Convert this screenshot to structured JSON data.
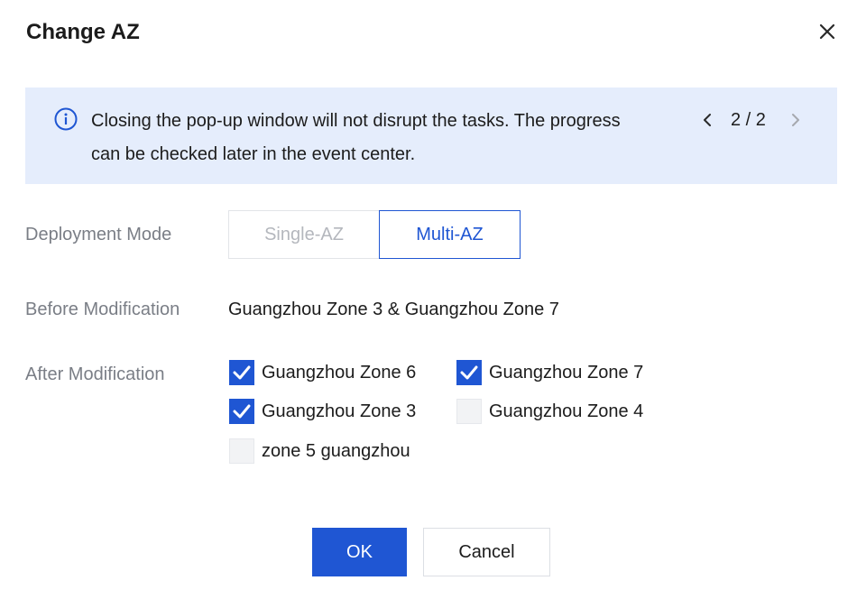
{
  "dialog": {
    "title": "Change AZ",
    "close_icon": "close-icon"
  },
  "banner": {
    "icon": "info-icon",
    "message": "Closing the pop-up window will not disrupt the tasks. The progress can be checked later in the event center.",
    "pager": "2 / 2",
    "prev_icon": "chevron-left-icon",
    "next_icon": "chevron-right-icon"
  },
  "deployment": {
    "label": "Deployment Mode",
    "options": [
      "Single-AZ",
      "Multi-AZ"
    ],
    "selected": "Multi-AZ"
  },
  "before": {
    "label": "Before Modification",
    "value": "Guangzhou Zone 3 & Guangzhou Zone 7"
  },
  "after": {
    "label": "After Modification",
    "zones": [
      {
        "label": "Guangzhou Zone 6",
        "checked": true
      },
      {
        "label": "Guangzhou Zone 7",
        "checked": true
      },
      {
        "label": "Guangzhou Zone 3",
        "checked": true
      },
      {
        "label": "Guangzhou Zone 4",
        "checked": false
      },
      {
        "label": "zone 5 guangzhou",
        "checked": false
      }
    ]
  },
  "footer": {
    "ok_label": "OK",
    "cancel_label": "Cancel"
  },
  "colors": {
    "primary": "#1f56d3",
    "banner_bg": "#e5edfc",
    "muted_label": "#7a7e86"
  }
}
